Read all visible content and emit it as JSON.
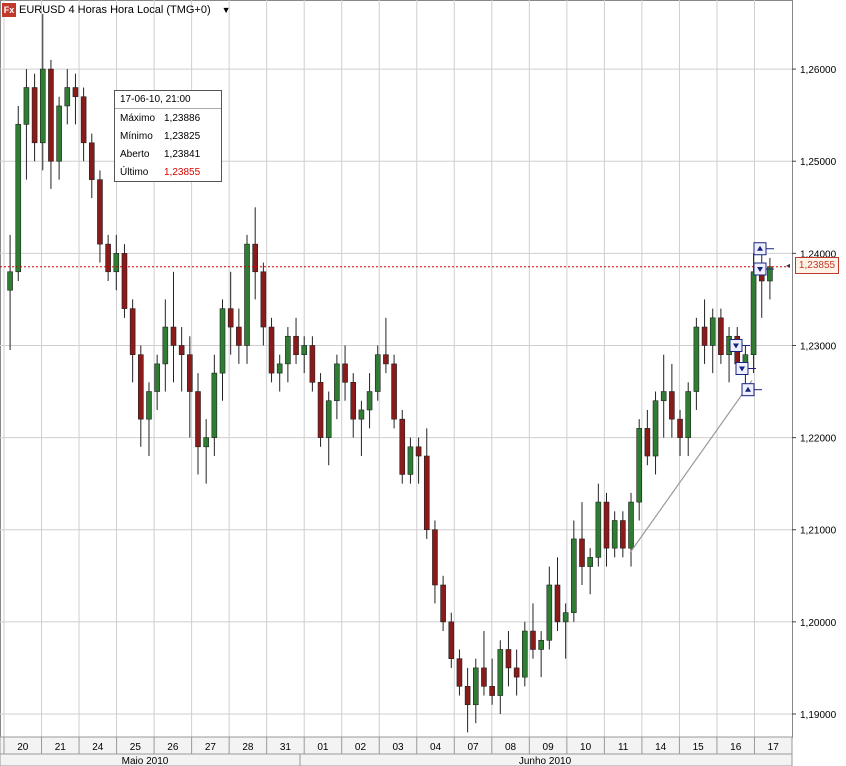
{
  "window": {
    "logo_text": "Fx",
    "title": "EURUSD 4 Horas Hora Local (TMG+0)",
    "dropdown_glyph": "▼"
  },
  "info_box": {
    "datetime": "17-06-10, 21:00",
    "rows": [
      {
        "label": "Máximo",
        "value": "1,23886"
      },
      {
        "label": "Mínimo",
        "value": "1,23825"
      },
      {
        "label": "Aberto",
        "value": "1,23841"
      },
      {
        "label": "Último",
        "value": "1,23855"
      }
    ]
  },
  "current_price": "1,23855",
  "colors": {
    "bull": "#2e7d32",
    "bear": "#8b1a1a",
    "grid": "#cfcfcf",
    "price_line": "#cc0000",
    "trendline": "#9a9a9a",
    "marker": "#1a237e"
  },
  "chart_data": {
    "type": "candlestick",
    "symbol": "EURUSD",
    "timeframe": "4 Horas",
    "ylim": [
      1.1875,
      1.2675
    ],
    "y_ticks": [
      "1,26000",
      "1,25000",
      "1,24000",
      "1,23000",
      "1,22000",
      "1,21000",
      "1,20000",
      "1,19000"
    ],
    "y_tick_values": [
      1.26,
      1.25,
      1.24,
      1.23,
      1.22,
      1.21,
      1.2,
      1.19
    ],
    "day_labels": [
      "20",
      "21",
      "24",
      "25",
      "26",
      "27",
      "28",
      "31",
      "01",
      "02",
      "03",
      "04",
      "07",
      "08",
      "09",
      "10",
      "11",
      "14",
      "15",
      "16",
      "17"
    ],
    "month_labels": [
      "Maio 2010",
      "Junho 2010"
    ],
    "last_price": 1.23855,
    "candles": [
      [
        1.236,
        1.242,
        1.2295,
        1.238
      ],
      [
        1.238,
        1.256,
        1.237,
        1.254
      ],
      [
        1.254,
        1.26,
        1.248,
        1.258
      ],
      [
        1.258,
        1.2595,
        1.25,
        1.252
      ],
      [
        1.252,
        1.266,
        1.249,
        1.26
      ],
      [
        1.26,
        1.261,
        1.247,
        1.25
      ],
      [
        1.25,
        1.257,
        1.248,
        1.256
      ],
      [
        1.256,
        1.26,
        1.254,
        1.258
      ],
      [
        1.258,
        1.2595,
        1.254,
        1.257
      ],
      [
        1.257,
        1.258,
        1.25,
        1.252
      ],
      [
        1.252,
        1.253,
        1.246,
        1.248
      ],
      [
        1.248,
        1.249,
        1.239,
        1.241
      ],
      [
        1.241,
        1.242,
        1.237,
        1.238
      ],
      [
        1.238,
        1.242,
        1.236,
        1.24
      ],
      [
        1.24,
        1.241,
        1.233,
        1.234
      ],
      [
        1.234,
        1.235,
        1.226,
        1.229
      ],
      [
        1.229,
        1.23,
        1.219,
        1.222
      ],
      [
        1.222,
        1.226,
        1.218,
        1.225
      ],
      [
        1.225,
        1.229,
        1.223,
        1.228
      ],
      [
        1.228,
        1.235,
        1.225,
        1.232
      ],
      [
        1.232,
        1.238,
        1.226,
        1.23
      ],
      [
        1.23,
        1.232,
        1.225,
        1.229
      ],
      [
        1.229,
        1.231,
        1.22,
        1.225
      ],
      [
        1.225,
        1.227,
        1.216,
        1.219
      ],
      [
        1.219,
        1.222,
        1.215,
        1.22
      ],
      [
        1.22,
        1.229,
        1.218,
        1.227
      ],
      [
        1.227,
        1.235,
        1.224,
        1.234
      ],
      [
        1.234,
        1.238,
        1.229,
        1.232
      ],
      [
        1.232,
        1.234,
        1.228,
        1.23
      ],
      [
        1.23,
        1.242,
        1.228,
        1.241
      ],
      [
        1.241,
        1.245,
        1.235,
        1.238
      ],
      [
        1.238,
        1.239,
        1.23,
        1.232
      ],
      [
        1.232,
        1.233,
        1.226,
        1.227
      ],
      [
        1.227,
        1.229,
        1.225,
        1.228
      ],
      [
        1.228,
        1.232,
        1.226,
        1.231
      ],
      [
        1.231,
        1.233,
        1.228,
        1.229
      ],
      [
        1.229,
        1.231,
        1.227,
        1.23
      ],
      [
        1.23,
        1.231,
        1.225,
        1.226
      ],
      [
        1.226,
        1.227,
        1.219,
        1.22
      ],
      [
        1.22,
        1.225,
        1.217,
        1.224
      ],
      [
        1.224,
        1.229,
        1.222,
        1.228
      ],
      [
        1.228,
        1.23,
        1.224,
        1.226
      ],
      [
        1.226,
        1.227,
        1.22,
        1.222
      ],
      [
        1.222,
        1.224,
        1.218,
        1.223
      ],
      [
        1.223,
        1.227,
        1.221,
        1.225
      ],
      [
        1.225,
        1.23,
        1.224,
        1.229
      ],
      [
        1.229,
        1.233,
        1.227,
        1.228
      ],
      [
        1.228,
        1.229,
        1.221,
        1.222
      ],
      [
        1.222,
        1.223,
        1.215,
        1.216
      ],
      [
        1.216,
        1.22,
        1.215,
        1.219
      ],
      [
        1.219,
        1.22,
        1.215,
        1.218
      ],
      [
        1.218,
        1.221,
        1.209,
        1.21
      ],
      [
        1.21,
        1.211,
        1.202,
        1.204
      ],
      [
        1.204,
        1.205,
        1.199,
        1.2
      ],
      [
        1.2,
        1.201,
        1.195,
        1.196
      ],
      [
        1.196,
        1.197,
        1.192,
        1.193
      ],
      [
        1.193,
        1.195,
        1.188,
        1.191
      ],
      [
        1.191,
        1.196,
        1.189,
        1.195
      ],
      [
        1.195,
        1.199,
        1.192,
        1.193
      ],
      [
        1.193,
        1.196,
        1.191,
        1.192
      ],
      [
        1.192,
        1.198,
        1.19,
        1.197
      ],
      [
        1.197,
        1.199,
        1.193,
        1.195
      ],
      [
        1.195,
        1.197,
        1.192,
        1.194
      ],
      [
        1.194,
        1.2,
        1.193,
        1.199
      ],
      [
        1.199,
        1.202,
        1.196,
        1.197
      ],
      [
        1.197,
        1.199,
        1.194,
        1.198
      ],
      [
        1.198,
        1.206,
        1.197,
        1.204
      ],
      [
        1.204,
        1.207,
        1.199,
        1.2
      ],
      [
        1.2,
        1.202,
        1.196,
        1.201
      ],
      [
        1.201,
        1.211,
        1.2,
        1.209
      ],
      [
        1.209,
        1.213,
        1.204,
        1.206
      ],
      [
        1.206,
        1.208,
        1.203,
        1.207
      ],
      [
        1.207,
        1.215,
        1.206,
        1.213
      ],
      [
        1.213,
        1.214,
        1.206,
        1.208
      ],
      [
        1.208,
        1.212,
        1.207,
        1.211
      ],
      [
        1.211,
        1.212,
        1.207,
        1.208
      ],
      [
        1.208,
        1.214,
        1.206,
        1.213
      ],
      [
        1.213,
        1.222,
        1.211,
        1.221
      ],
      [
        1.221,
        1.223,
        1.217,
        1.218
      ],
      [
        1.218,
        1.225,
        1.216,
        1.224
      ],
      [
        1.224,
        1.229,
        1.22,
        1.225
      ],
      [
        1.225,
        1.228,
        1.22,
        1.222
      ],
      [
        1.222,
        1.223,
        1.218,
        1.22
      ],
      [
        1.22,
        1.226,
        1.218,
        1.225
      ],
      [
        1.225,
        1.233,
        1.223,
        1.232
      ],
      [
        1.232,
        1.235,
        1.228,
        1.23
      ],
      [
        1.23,
        1.234,
        1.227,
        1.233
      ],
      [
        1.233,
        1.234,
        1.228,
        1.229
      ],
      [
        1.229,
        1.232,
        1.226,
        1.231
      ],
      [
        1.231,
        1.232,
        1.227,
        1.228
      ],
      [
        1.228,
        1.23,
        1.225,
        1.229
      ],
      [
        1.229,
        1.24,
        1.227,
        1.238
      ],
      [
        1.238,
        1.24,
        1.233,
        1.237
      ],
      [
        1.237,
        1.2395,
        1.235,
        1.23855
      ]
    ],
    "trendline": {
      "from": [
        1.2075
      ],
      "to": [
        1.2262
      ]
    }
  }
}
